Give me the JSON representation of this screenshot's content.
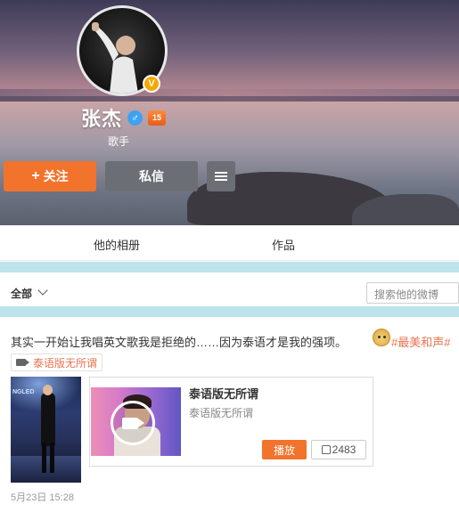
{
  "profile": {
    "name": "张杰",
    "profession": "歌手",
    "verified_symbol": "V",
    "gender_symbol": "♂",
    "level_badge": "15"
  },
  "actions": {
    "follow_plus": "+",
    "follow_label": "关注",
    "message_label": "私信"
  },
  "tabs": [
    {
      "label": "他的相册"
    },
    {
      "label": "作品"
    }
  ],
  "filter": {
    "all_label": "全部",
    "search_placeholder": "搜索他的微博"
  },
  "post": {
    "text": "其实一开始让我唱英文歌我是拒绝的……因为泰语才是我的强项。",
    "hashtag": "#最美和声#",
    "video_tag": "泰语版无所谓",
    "thumb_sign": "NGLED",
    "card": {
      "title": "泰语版无所谓",
      "subtitle": "泰语版无所谓",
      "play_label": "播放",
      "likes": "2483"
    },
    "timestamp": "5月23日 15:28"
  },
  "colors": {
    "accent": "#f2732c",
    "link": "#eb7350",
    "separator": "#bde3eb",
    "button_gray": "#6b6e75"
  }
}
